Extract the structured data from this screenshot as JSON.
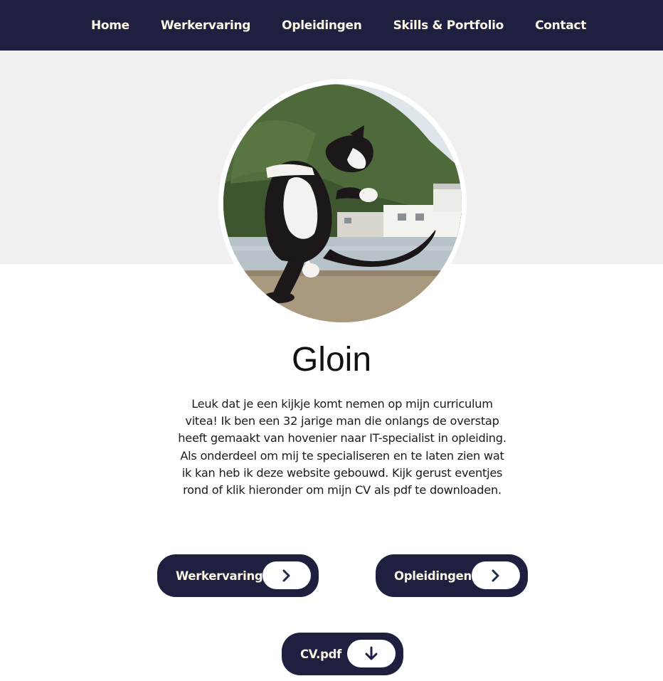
{
  "nav": {
    "items": [
      {
        "label": "Home"
      },
      {
        "label": "Werkervaring"
      },
      {
        "label": "Opleidingen"
      },
      {
        "label": "Skills & Portfolio"
      },
      {
        "label": "Contact"
      }
    ]
  },
  "profile": {
    "name": "Gloin",
    "intro": "Leuk dat je een kijkje komt nemen op mijn curriculum vitea! Ik ben een 32 jarige man die onlangs de overstap heeft gemaakt van hovenier naar IT-specialist in opleiding. Als onderdeel om mij te specialiseren en te laten zien wat ik kan heb ik deze website gebouwd. Kijk gerust eventjes rond of klik hieronder om mijn CV als pdf te downloaden."
  },
  "buttons": {
    "werkervaring": {
      "label": "Werkervaring",
      "icon": "chevron-right-icon"
    },
    "opleidingen": {
      "label": "Opleidingen",
      "icon": "chevron-right-icon"
    },
    "cv": {
      "label": "CV.pdf",
      "icon": "arrow-down-icon"
    }
  },
  "colors": {
    "navy": "#1f2040",
    "cream_text": "#fbf5e6",
    "hero_band": "#f0f0f0",
    "icon_chevron": "#1c2b4a",
    "icon_download": "#2a1a4a"
  }
}
